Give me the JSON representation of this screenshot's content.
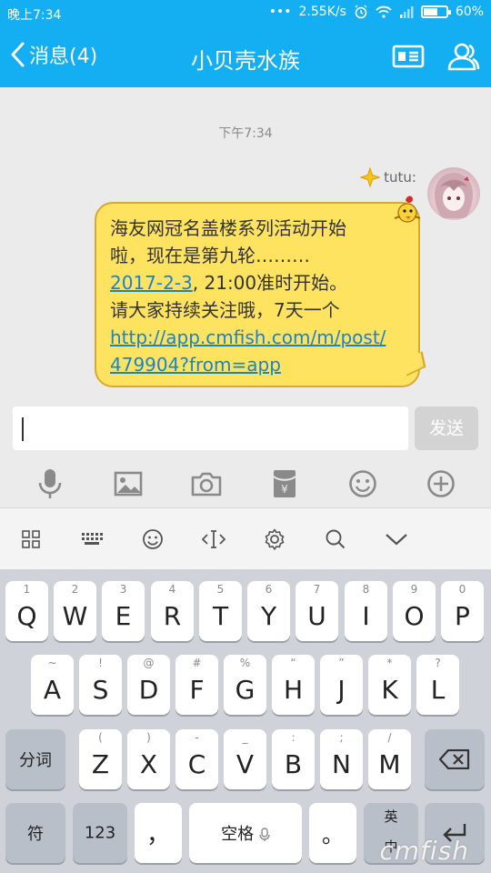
{
  "status_bar": {
    "time": "晚上7:34",
    "dots": "•••",
    "speed": "2.55K/s",
    "battery": "60%",
    "battery_level": 0.6
  },
  "header": {
    "back_label": "消息(4)",
    "title": "小贝壳水族",
    "icons": [
      "back-icon",
      "profile-card-icon",
      "group-members-icon"
    ]
  },
  "chat": {
    "timestamp": "下午7:34",
    "sender_name": "tutu:",
    "message_lines": [
      "海友网冠名盖楼系列活动开始",
      "啦，现在是第九轮………",
      "2017-2-3",
      ", 21:00准时开始。",
      "请大家持续关注哦，7天一个",
      "http://app.cmfish.com/m/post/",
      "479904?from=app"
    ]
  },
  "composer": {
    "send_label": "发送",
    "tools": [
      "microphone-icon",
      "image-icon",
      "camera-icon",
      "red-packet-icon",
      "emoji-icon",
      "plus-icon"
    ]
  },
  "keyboard_tools": [
    "grid-icon",
    "keyboard-icon",
    "emoji-icon",
    "cursor-icon",
    "settings-icon",
    "search-icon",
    "collapse-icon"
  ],
  "keyboard": {
    "row1": [
      {
        "sub": "1",
        "main": "Q"
      },
      {
        "sub": "2",
        "main": "W"
      },
      {
        "sub": "3",
        "main": "E"
      },
      {
        "sub": "4",
        "main": "R"
      },
      {
        "sub": "5",
        "main": "T"
      },
      {
        "sub": "6",
        "main": "Y"
      },
      {
        "sub": "7",
        "main": "U"
      },
      {
        "sub": "8",
        "main": "I"
      },
      {
        "sub": "9",
        "main": "O"
      },
      {
        "sub": "0",
        "main": "P"
      }
    ],
    "row2": [
      {
        "sub": "~",
        "main": "A"
      },
      {
        "sub": "!",
        "main": "S"
      },
      {
        "sub": "@",
        "main": "D"
      },
      {
        "sub": "#",
        "main": "F"
      },
      {
        "sub": "%",
        "main": "G"
      },
      {
        "sub": "“",
        "main": "H"
      },
      {
        "sub": "”",
        "main": "J"
      },
      {
        "sub": "*",
        "main": "K"
      },
      {
        "sub": "?",
        "main": "L"
      }
    ],
    "row3": [
      {
        "sub": "(",
        "main": "Z"
      },
      {
        "sub": ")",
        "main": "X"
      },
      {
        "sub": "-",
        "main": "C"
      },
      {
        "sub": "_",
        "main": "V"
      },
      {
        "sub": ":",
        "main": "B"
      },
      {
        "sub": ";",
        "main": "N"
      },
      {
        "sub": "/",
        "main": "M"
      }
    ],
    "fenci": "分词",
    "fu": "符",
    "num": "123",
    "comma": "，",
    "space": "空格",
    "period": "。",
    "lang_en": "英",
    "lang_zh": "中"
  },
  "watermark": "cmfish"
}
